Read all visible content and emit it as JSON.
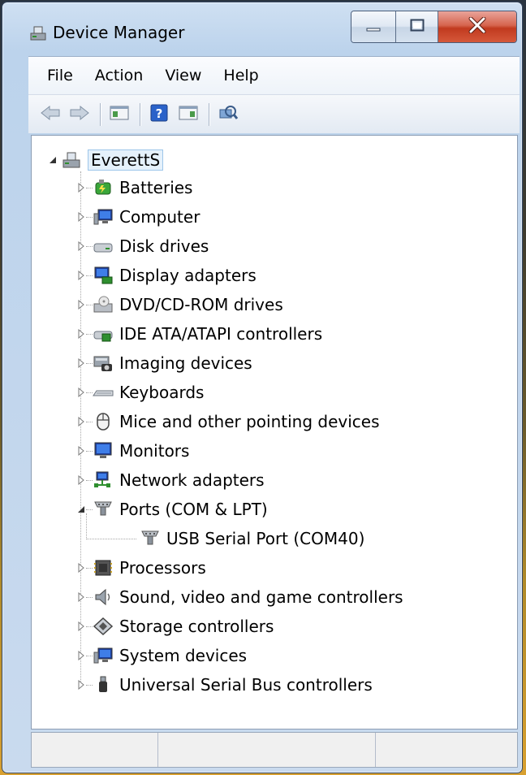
{
  "window": {
    "title": "Device Manager",
    "minimize_icon": "minimize-icon",
    "maximize_icon": "maximize-icon",
    "close_icon": "close-icon"
  },
  "menu": [
    "File",
    "Action",
    "View",
    "Help"
  ],
  "toolbar": {
    "buttons": [
      "back-arrow-icon",
      "forward-arrow-icon",
      "properties-pane-icon",
      "help-icon",
      "properties-icon",
      "scan-hardware-icon"
    ]
  },
  "tree": {
    "root": {
      "label": "EverettS",
      "icon": "computer-icon",
      "expanded": true
    },
    "categories": [
      {
        "label": "Batteries",
        "icon": "battery-icon"
      },
      {
        "label": "Computer",
        "icon": "computer-icon"
      },
      {
        "label": "Disk drives",
        "icon": "disk-drive-icon"
      },
      {
        "label": "Display adapters",
        "icon": "display-adapter-icon"
      },
      {
        "label": "DVD/CD-ROM drives",
        "icon": "dvd-drive-icon"
      },
      {
        "label": "IDE ATA/ATAPI controllers",
        "icon": "ide-controller-icon"
      },
      {
        "label": "Imaging devices",
        "icon": "camera-icon"
      },
      {
        "label": "Keyboards",
        "icon": "keyboard-icon"
      },
      {
        "label": "Mice and other pointing devices",
        "icon": "mouse-icon"
      },
      {
        "label": "Monitors",
        "icon": "monitor-icon"
      },
      {
        "label": "Network adapters",
        "icon": "network-adapter-icon"
      },
      {
        "label": "Ports (COM & LPT)",
        "icon": "port-icon",
        "expanded": true,
        "children": [
          {
            "label": "USB Serial Port (COM40)",
            "icon": "port-icon"
          }
        ]
      },
      {
        "label": "Processors",
        "icon": "processor-icon"
      },
      {
        "label": "Sound, video and game controllers",
        "icon": "speaker-icon"
      },
      {
        "label": "Storage controllers",
        "icon": "storage-controller-icon"
      },
      {
        "label": "System devices",
        "icon": "system-device-icon"
      },
      {
        "label": "Universal Serial Bus controllers",
        "icon": "usb-icon"
      }
    ]
  },
  "statusbar": {
    "cells": [
      "",
      "",
      ""
    ]
  },
  "colors": {
    "selection_border": "#9ec6ea",
    "selection_fill": "#e5f1fb",
    "close_button": "#c13a1f"
  }
}
